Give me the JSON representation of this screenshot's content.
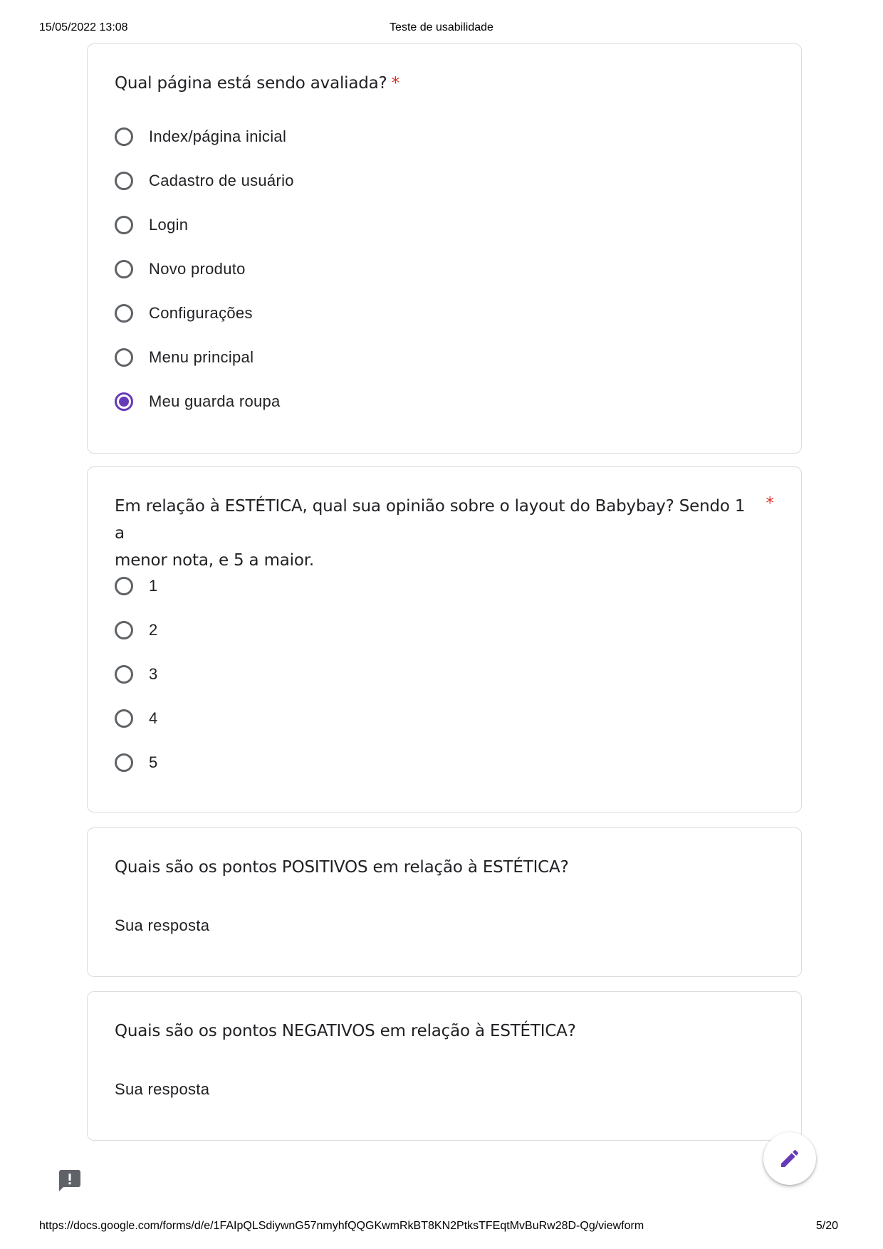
{
  "print_header": {
    "datetime": "15/05/2022 13:08",
    "title": "Teste de usabilidade"
  },
  "print_footer": {
    "url": "https://docs.google.com/forms/d/e/1FAIpQLSdiywnG57nmyhfQQGKwmRkBT8KN2PtksTFEqtMvBuRw28D-Qg/viewform",
    "page": "5/20"
  },
  "questions": [
    {
      "title": "Qual página está sendo avaliada?",
      "required_mark": "*",
      "options": [
        "Index/página inicial",
        "Cadastro de usuário",
        "Login",
        "Novo produto",
        "Configurações",
        "Menu principal",
        "Meu guarda roupa"
      ],
      "selected": "Meu guarda roupa"
    },
    {
      "title_line1": "Em relação à ESTÉTICA, qual sua opinião sobre o layout do Babybay? Sendo 1 a",
      "title_line2": "menor nota, e 5 a maior.",
      "required_mark": "*",
      "options": [
        "1",
        "2",
        "3",
        "4",
        "5"
      ]
    },
    {
      "title": "Quais são os pontos POSITIVOS em relação à ESTÉTICA?",
      "placeholder": "Sua resposta"
    },
    {
      "title": "Quais são os pontos NEGATIVOS em relação à ESTÉTICA?",
      "placeholder": "Sua resposta"
    }
  ],
  "icons": {
    "fab": "pencil-icon",
    "report": "report-problem-icon"
  },
  "colors": {
    "accent": "#673ab7",
    "required": "#d93025",
    "radio": "#5f6368",
    "border": "#dadce0"
  }
}
